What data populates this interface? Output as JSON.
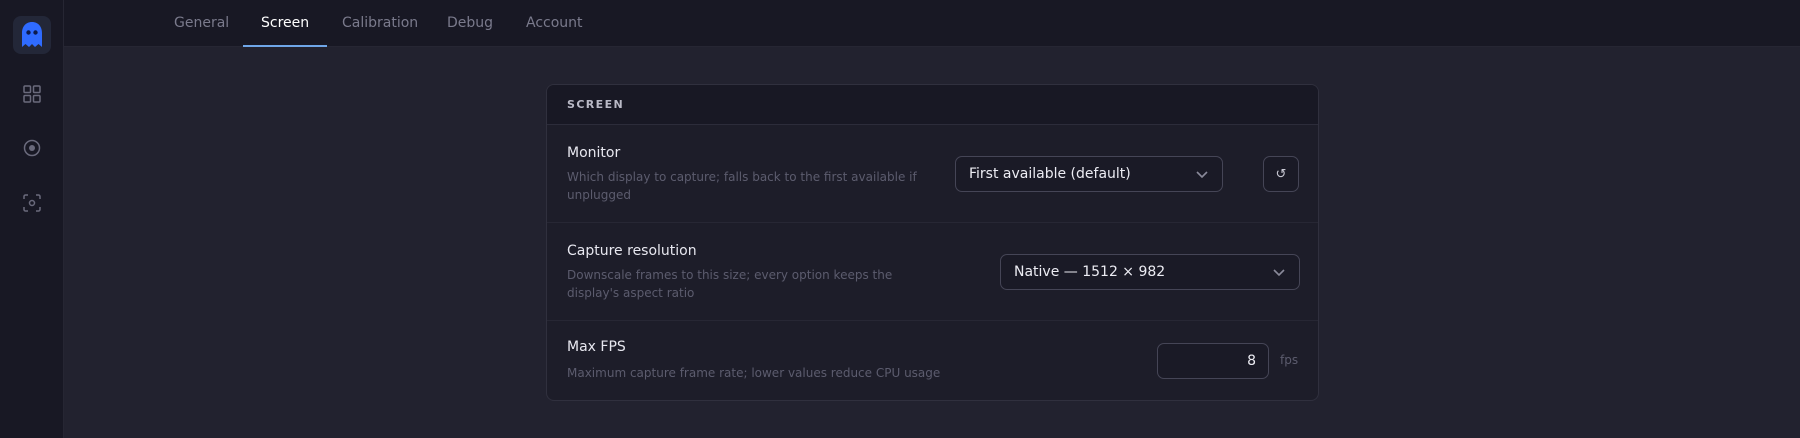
{
  "sidebar": {
    "items": [
      {
        "icon": "ghost-logo-icon"
      },
      {
        "icon": "grid-icon"
      },
      {
        "icon": "record-icon"
      },
      {
        "icon": "screen-capture-icon"
      }
    ]
  },
  "tabs": [
    {
      "label": "General",
      "active": false
    },
    {
      "label": "Screen",
      "active": true
    },
    {
      "label": "Calibration",
      "active": false
    },
    {
      "label": "Debug",
      "active": false
    },
    {
      "label": "Account",
      "active": false
    }
  ],
  "card": {
    "title": "SCREEN",
    "rows": {
      "monitor": {
        "title": "Monitor",
        "description": "Which display to capture; falls back to the first available if unplugged",
        "selected": "First available (default)",
        "refresh_glyph": "↺"
      },
      "resolution": {
        "title": "Capture resolution",
        "description": "Downscale frames to this size; every option keeps the display's aspect ratio",
        "selected": "Native — 1512 × 982"
      },
      "fps": {
        "title": "Max FPS",
        "description": "Maximum capture frame rate; lower values reduce CPU usage",
        "value": "8",
        "unit": "fps"
      }
    }
  },
  "colors": {
    "accent": "#6fa6e8",
    "logo_blue": "#2f6bff",
    "background": "#22222f",
    "panel": "#1d1d29"
  }
}
